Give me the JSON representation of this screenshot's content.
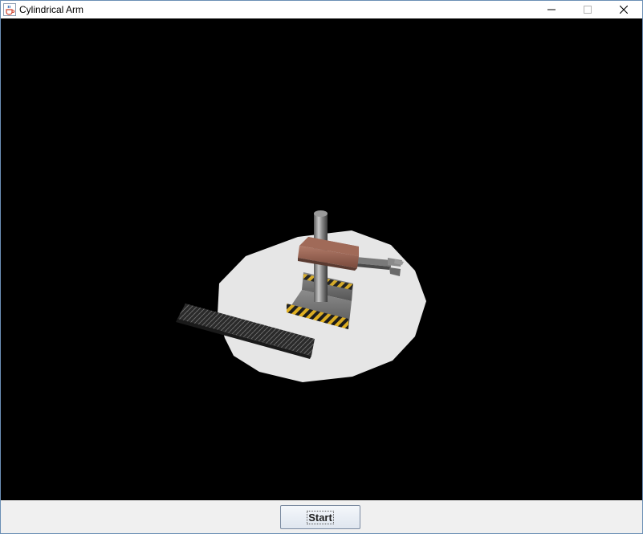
{
  "window": {
    "title": "Cylindrical Arm",
    "icon": "java-cup-icon",
    "controls": {
      "minimize_icon": "minimize-icon",
      "maximize_icon": "maximize-icon",
      "close_icon": "close-icon"
    }
  },
  "scene": {
    "background": "#000000",
    "floor_color": "#e6e6e6",
    "objects": [
      "floor-disc",
      "conveyor-plate",
      "robot-base",
      "robot-column",
      "robot-carriage",
      "robot-gripper-arm"
    ]
  },
  "controls": {
    "start_label": "Start"
  }
}
